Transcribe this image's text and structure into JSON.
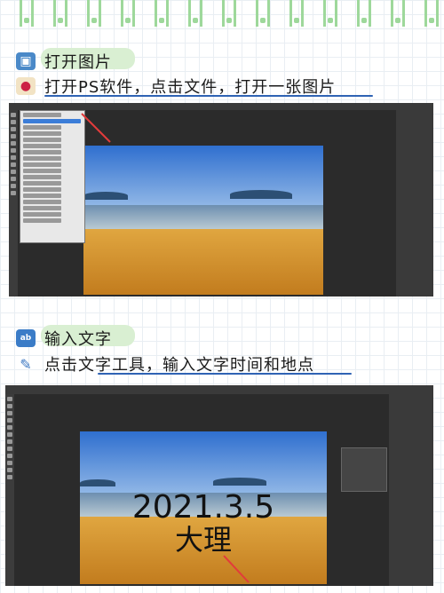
{
  "step1": {
    "title": "打开图片",
    "desc": "打开PS软件，点击文件，打开一张图片",
    "icon_title": "picture-icon",
    "icon_desc": "palette-icon"
  },
  "step2": {
    "title": "输入文字",
    "desc": "点击文字工具，输入文字时间和地点",
    "icon_title": "abcd-icon",
    "icon_desc": "wrench-icon",
    "ps_text_date": "2021.3.5",
    "ps_text_place": "大理"
  },
  "colors": {
    "accent_green": "#9ed89b",
    "highlight": "#d9efd2",
    "underline": "#2f63b4",
    "arrow": "#e23b3b"
  }
}
